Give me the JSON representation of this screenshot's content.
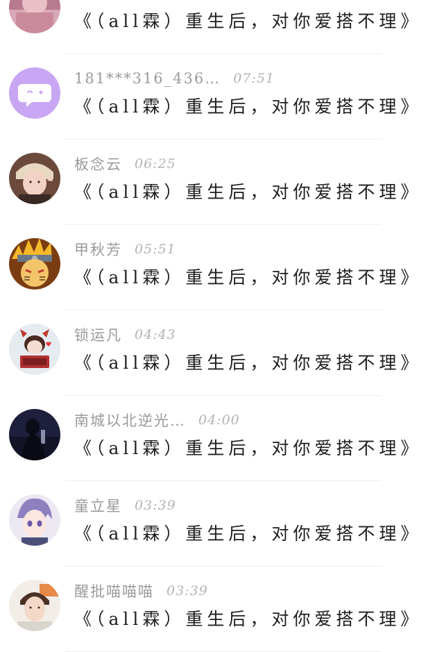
{
  "comments": [
    {
      "avatar": "pink-photo-avatar",
      "nickname": "",
      "time": "",
      "message": "《（all霖）重生后，对你爱搭不理》"
    },
    {
      "avatar": "chat-bubble-default-avatar",
      "nickname": "181***316_436…",
      "time": "07:51",
      "message": "《（all霖）重生后，对你爱搭不理》"
    },
    {
      "avatar": "girl-photo-avatar",
      "nickname": "板念云",
      "time": "06:25",
      "message": "《（all霖）重生后，对你爱搭不理》"
    },
    {
      "avatar": "naruto-avatar",
      "nickname": "甲秋芳",
      "time": "05:51",
      "message": "《（all霖）重生后，对你爱搭不理》"
    },
    {
      "avatar": "cartoon-girl-avatar",
      "nickname": "锁运凡",
      "time": "04:43",
      "message": "《（all霖）重生后，对你爱搭不理》"
    },
    {
      "avatar": "night-silhouette-avatar",
      "nickname": "南城以北逆光…",
      "time": "04:00",
      "message": "《（all霖）重生后，对你爱搭不理》"
    },
    {
      "avatar": "anime-boy-avatar",
      "nickname": "童立星",
      "time": "03:39",
      "message": "《（all霖）重生后，对你爱搭不理》"
    },
    {
      "avatar": "boy-photo-avatar",
      "nickname": "醒批喵喵喵",
      "time": "03:39",
      "message": "《（all霖）重生后，对你爱搭不理》"
    }
  ],
  "colors": {
    "nickname": "#9a9a9a",
    "time": "#b3b3b3",
    "message": "#1e1e1e",
    "divider": "#eeeeee",
    "default_avatar_bg": "#c9a6f4"
  }
}
